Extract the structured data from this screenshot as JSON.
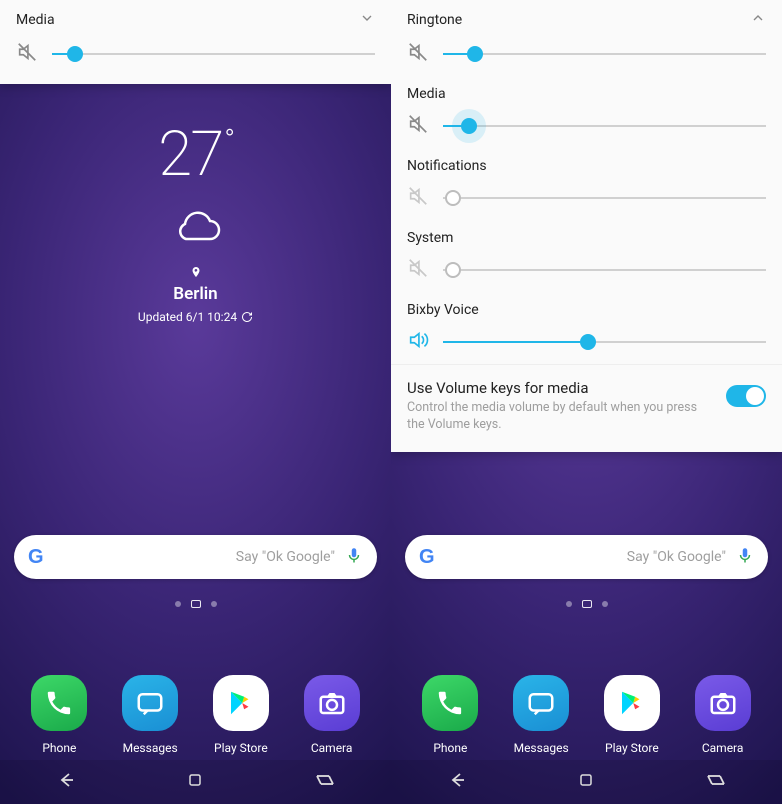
{
  "left": {
    "volume": {
      "label": "Media",
      "percent": 7
    },
    "chevron": "expand",
    "weather": {
      "temp": "27",
      "city": "Berlin",
      "updated": "Updated 6/1 10:24"
    },
    "search_placeholder": "Say \"Ok Google\"",
    "dock": [
      {
        "name": "phone",
        "label": "Phone"
      },
      {
        "name": "messages",
        "label": "Messages"
      },
      {
        "name": "play-store",
        "label": "Play Store"
      },
      {
        "name": "camera",
        "label": "Camera"
      }
    ]
  },
  "right": {
    "chevron": "collapse",
    "volume_groups": [
      {
        "key": "ringtone",
        "label": "Ringtone",
        "percent": 10,
        "muted": true,
        "active": true
      },
      {
        "key": "media",
        "label": "Media",
        "percent": 8,
        "muted": true,
        "active": true,
        "halo": true
      },
      {
        "key": "notifications",
        "label": "Notifications",
        "percent": 0,
        "muted": true,
        "active": false
      },
      {
        "key": "system",
        "label": "System",
        "percent": 0,
        "muted": true,
        "active": false
      },
      {
        "key": "bixby",
        "label": "Bixby Voice",
        "percent": 45,
        "muted": false,
        "active": true
      }
    ],
    "setting": {
      "title": "Use Volume keys for media",
      "subtitle": "Control the media volume by default when you press the Volume keys.",
      "on": true
    },
    "search_placeholder": "Say \"Ok Google\"",
    "dock": [
      {
        "name": "phone",
        "label": "Phone"
      },
      {
        "name": "messages",
        "label": "Messages"
      },
      {
        "name": "play-store",
        "label": "Play Store"
      },
      {
        "name": "camera",
        "label": "Camera"
      }
    ]
  }
}
